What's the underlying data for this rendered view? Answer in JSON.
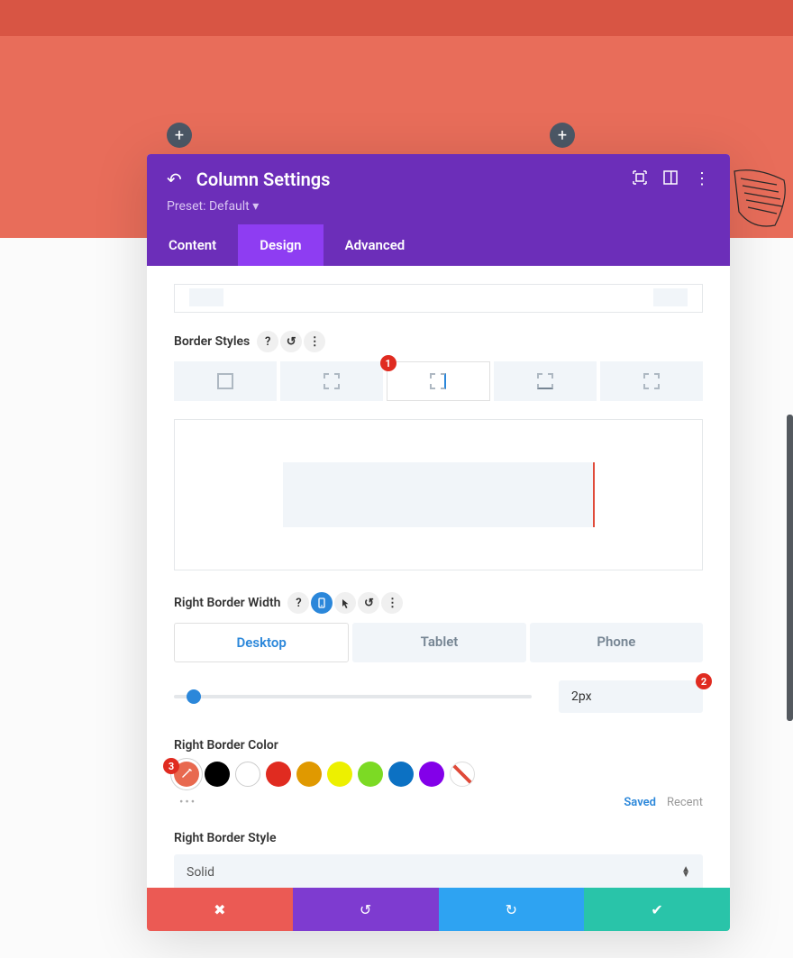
{
  "header": {
    "title": "Column Settings",
    "preset_label": "Preset: Default"
  },
  "tabs": {
    "content": "Content",
    "design": "Design",
    "advanced": "Advanced"
  },
  "sections": {
    "border_styles_label": "Border Styles",
    "right_border_width_label": "Right Border Width",
    "right_border_color_label": "Right Border Color",
    "right_border_style_label": "Right Border Style"
  },
  "device_tabs": {
    "desktop": "Desktop",
    "tablet": "Tablet",
    "phone": "Phone"
  },
  "width_value": "2px",
  "saved_label": "Saved",
  "recent_label": "Recent",
  "style_value": "Solid",
  "badges": {
    "b1": "1",
    "b2": "2",
    "b3": "3"
  },
  "colors": {
    "selected": "#e8694f",
    "black": "#000000",
    "white": "#ffffff",
    "red": "#e02b20",
    "orange": "#e09900",
    "yellow": "#edf000",
    "green": "#7cda24",
    "blue": "#0c71c3",
    "purple": "#8300e9"
  }
}
